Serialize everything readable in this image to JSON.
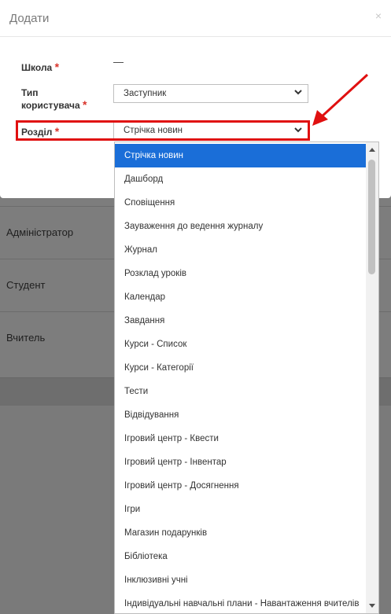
{
  "background": {
    "rows": [
      "Адміністратор",
      "Студент",
      "Вчитель"
    ]
  },
  "modal": {
    "title": "Додати",
    "close": "×",
    "fields": {
      "school_label": "Школа",
      "school_value": "—",
      "user_type_label": "Тип користувача",
      "user_type_value": "Заступник",
      "section_label": "Розділ",
      "section_value": "Стрічка новин",
      "required_mark": "*"
    }
  },
  "dropdown": {
    "selected_index": 0,
    "options": [
      "Стрічка новин",
      "Дашборд",
      "Сповіщення",
      "Зауваження до ведення журналу",
      "Журнал",
      "Розклад уроків",
      "Календар",
      "Завдання",
      "Курси - Список",
      "Курси - Категорії",
      "Тести",
      "Відвідування",
      "Ігровий центр - Квести",
      "Ігровий центр - Інвентар",
      "Ігровий центр - Досягнення",
      "Ігри",
      "Магазин подарунків",
      "Бібліотека",
      "Інклюзивні учні",
      "Індивідуальні навчальні плани - Навантаження вчителів"
    ]
  },
  "colors": {
    "accent": "#1a6ed8",
    "highlight": "#e01010",
    "required": "#d9342b"
  }
}
